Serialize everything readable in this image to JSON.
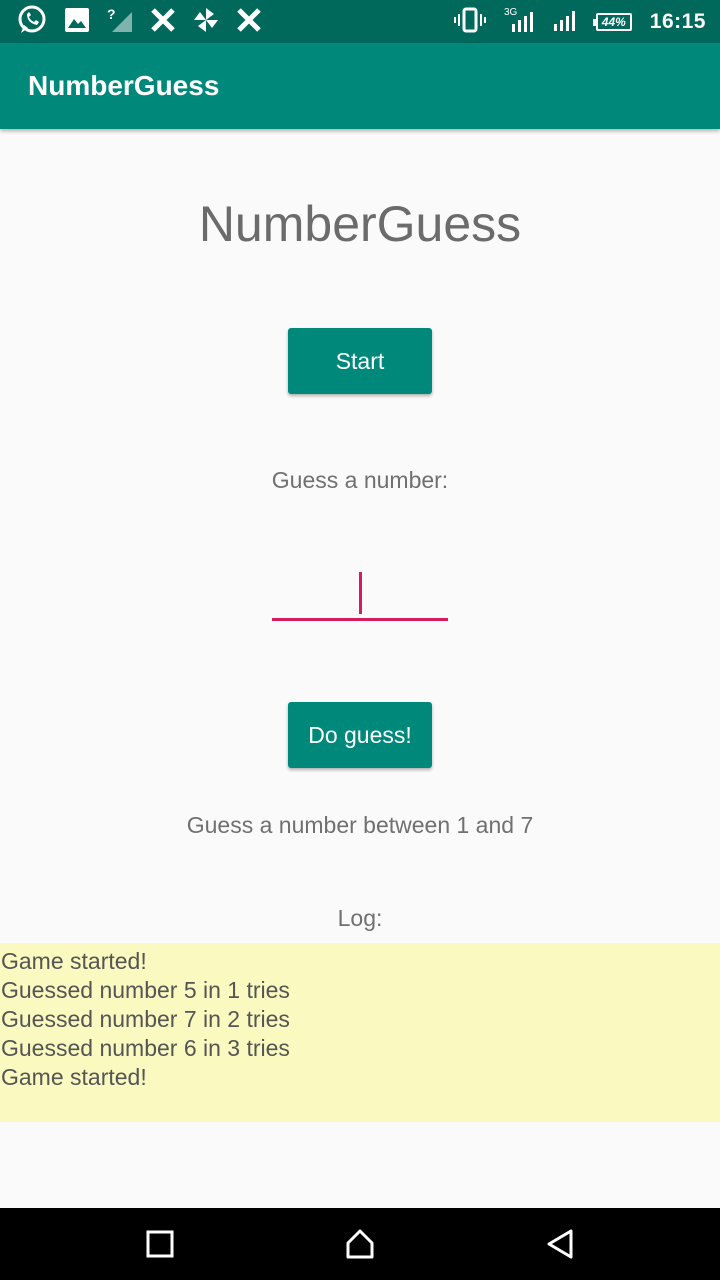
{
  "status_bar": {
    "time": "16:15",
    "battery": "44%",
    "network": "3G",
    "icons": [
      "whatsapp-icon",
      "image-icon",
      "no-signal-icon",
      "x-icon",
      "pinwheel-icon",
      "x-icon",
      "vibrate-icon",
      "signal-3g-icon",
      "signal-icon",
      "battery-icon"
    ]
  },
  "app_bar": {
    "title": "NumberGuess"
  },
  "main": {
    "heading": "NumberGuess",
    "start_button": "Start",
    "guess_label": "Guess a number:",
    "guess_input": {
      "value": "",
      "placeholder": ""
    },
    "guess_button": "Do guess!",
    "hint": "Guess a number between 1 and 7",
    "log_label": "Log:",
    "log": [
      "Game started!",
      "Guessed number 5 in 1 tries",
      "Guessed number 7 in 2 tries",
      "Guessed number 6 in 3 tries",
      "Game started!"
    ]
  },
  "colors": {
    "status_bar": "#00695c",
    "primary": "#00897b",
    "accent": "#d81b60",
    "log_background": "#fafac0"
  },
  "nav_bar": {
    "icons": [
      "recents-icon",
      "home-icon",
      "back-icon"
    ]
  }
}
